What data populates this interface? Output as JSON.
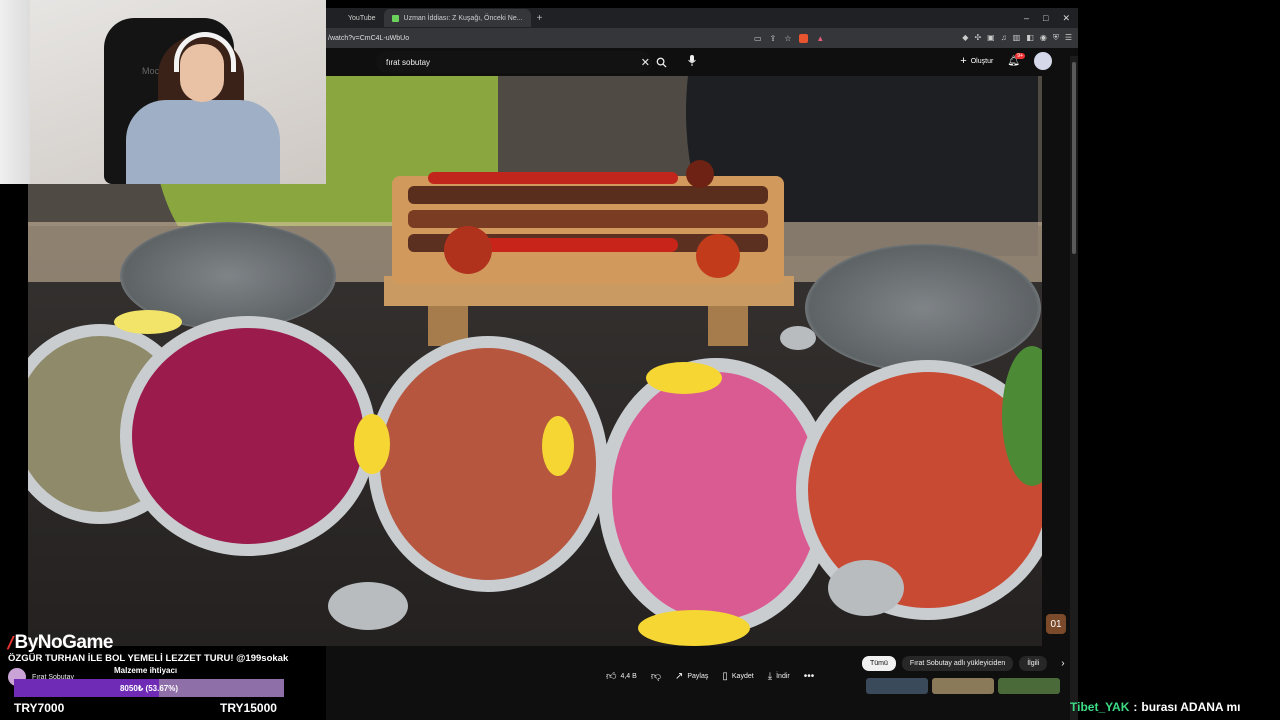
{
  "browser": {
    "tabs": [
      {
        "label": "YouTube",
        "favicon": "youtube-icon"
      },
      {
        "label": "Uzman İddiası: Z Kuşağı, Önceki Ne...",
        "favicon": "page-icon"
      }
    ],
    "new_tab": "+",
    "url": "/watch?v=CmC4L-uWbUo"
  },
  "youtube": {
    "search_value": "fırat sobutay",
    "create_label": "Oluştur",
    "notification_count": "9+",
    "like_count": "4,4 B",
    "share_label": "Paylaş",
    "save_label": "Kaydet",
    "download_label": "İndir",
    "chips": [
      "Tümü",
      "Fırat Sobutay adlı yükleyiciden",
      "İlgili"
    ],
    "watermark": "01"
  },
  "overlay": {
    "logo": "ByNoGame",
    "stream_title": "ÖZGÜR TURHAN İLE BOL YEMELİ LEZZET TURU! @199sokak",
    "channel_name": "Fırat Sobutay",
    "goal_label": "Malzeme ihtiyacı",
    "goal_progress_text": "8050₺ (53.67%)",
    "goal_progress_percent": 53.67,
    "goal_min": "TRY7000",
    "goal_max": "TRY15000"
  },
  "chat": {
    "user": "Tibet_YAK",
    "separator": ":",
    "message": "burası ADANA mı"
  },
  "webcam": {
    "chair_brand": "Mocken"
  },
  "colors": {
    "progress_fill": "#6f2bb5",
    "progress_bg": "#8f6fa8",
    "chat_user": "#3ddc84",
    "logo_mark": "#e3342f"
  }
}
